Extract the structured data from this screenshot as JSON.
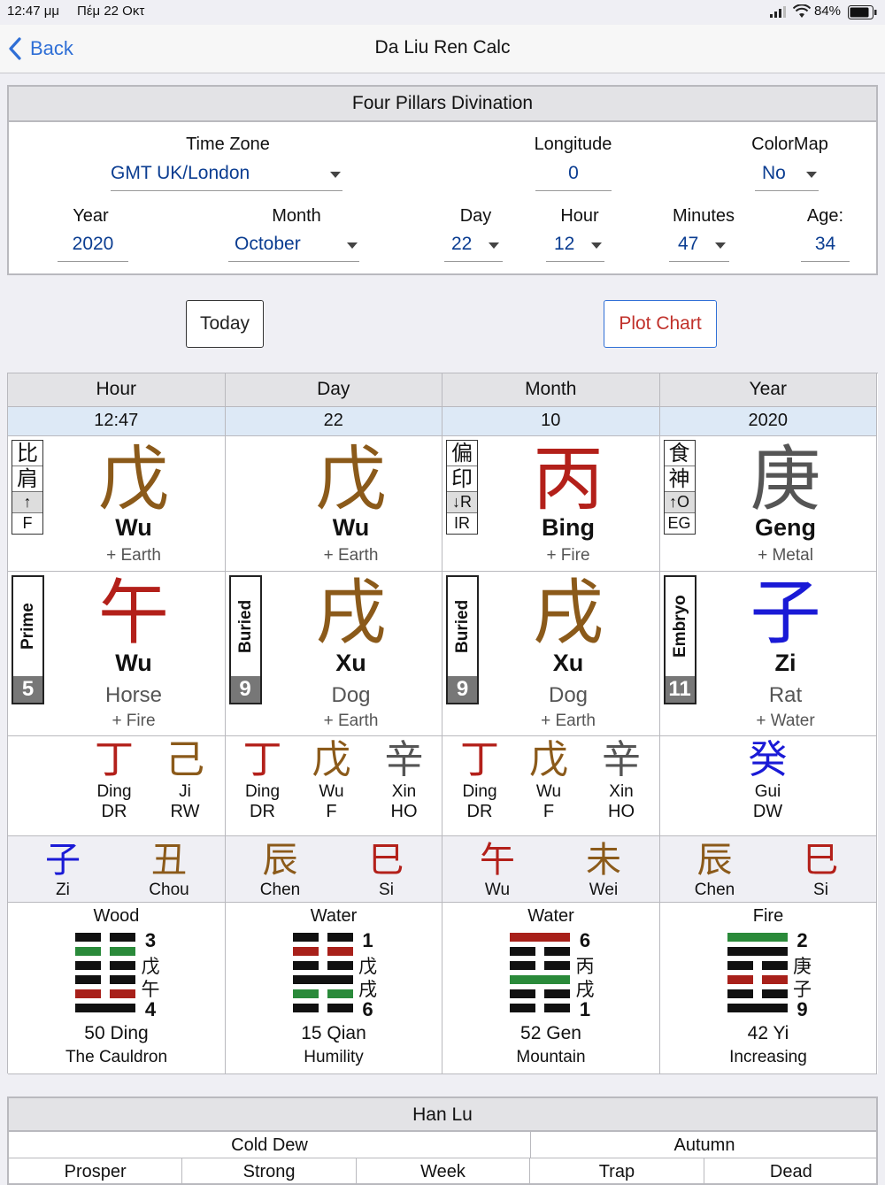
{
  "status": {
    "time": "12:47 μμ",
    "date": "Πέμ 22 Οκτ",
    "battery": "84%"
  },
  "nav": {
    "back": "Back",
    "title": "Da Liu Ren Calc"
  },
  "form": {
    "title": "Four Pillars Divination",
    "timezone_label": "Time Zone",
    "timezone_value": "GMT UK/London",
    "longitude_label": "Longitude",
    "longitude_value": "0",
    "colormap_label": "ColorMap",
    "colormap_value": "No",
    "year_label": "Year",
    "year_value": "2020",
    "month_label": "Month",
    "month_value": "October",
    "day_label": "Day",
    "day_value": "22",
    "hour_label": "Hour",
    "hour_value": "12",
    "minutes_label": "Minutes",
    "minutes_value": "47",
    "age_label": "Age:",
    "age_value": "34"
  },
  "buttons": {
    "today": "Today",
    "plot": "Plot Chart"
  },
  "colors": {
    "earth": "#8b5a1a",
    "fire": "#b3201a",
    "metal": "#555555",
    "water": "#1a1ad6",
    "accent": "#2f6fd6",
    "plot": "#c0302a"
  },
  "pillars": [
    {
      "header": "Hour",
      "value": "12:47",
      "stem": {
        "glyph": "戊",
        "pinyin": "Wu",
        "element": "+ Earth",
        "color": "#8b5a1a",
        "badge": [
          "比",
          "肩",
          "↑",
          "F"
        ]
      },
      "branch": {
        "glyph": "午",
        "pinyin": "Wu",
        "animal": "Horse",
        "element": "+ Fire",
        "color": "#b3201a",
        "tag": "Prime",
        "num": "5"
      },
      "hidden": [
        {
          "glyph": "丁",
          "name": "Ding",
          "code": "DR",
          "color": "#b3201a"
        },
        {
          "glyph": "己",
          "name": "Ji",
          "code": "RW",
          "color": "#8b5a1a"
        }
      ],
      "extra": [
        {
          "glyph": "子",
          "name": "Zi",
          "color": "#1a1ad6"
        },
        {
          "glyph": "丑",
          "name": "Chou",
          "color": "#8b5a1a"
        }
      ],
      "hex": {
        "element": "Wood",
        "nums": [
          "3",
          "戊",
          "午",
          "4"
        ],
        "name": "50 Ding",
        "meaning": "The Cauldron",
        "lines": [
          "y",
          "g",
          "y",
          "y",
          "r",
          "s"
        ]
      }
    },
    {
      "header": "Day",
      "value": "22",
      "stem": {
        "glyph": "戊",
        "pinyin": "Wu",
        "element": "+ Earth",
        "color": "#8b5a1a",
        "badge": []
      },
      "branch": {
        "glyph": "戌",
        "pinyin": "Xu",
        "animal": "Dog",
        "element": "+ Earth",
        "color": "#8b5a1a",
        "tag": "Buried",
        "num": "9"
      },
      "hidden": [
        {
          "glyph": "丁",
          "name": "Ding",
          "code": "DR",
          "color": "#b3201a"
        },
        {
          "glyph": "戊",
          "name": "Wu",
          "code": "F",
          "color": "#8b5a1a"
        },
        {
          "glyph": "辛",
          "name": "Xin",
          "code": "HO",
          "color": "#555555"
        }
      ],
      "extra": [
        {
          "glyph": "辰",
          "name": "Chen",
          "color": "#8b5a1a"
        },
        {
          "glyph": "巳",
          "name": "Si",
          "color": "#b3201a"
        }
      ],
      "hex": {
        "element": "Water",
        "nums": [
          "1",
          "戊",
          "戌",
          "6"
        ],
        "name": "15 Qian",
        "meaning": "Humility",
        "lines": [
          "b",
          "r",
          "b",
          "s",
          "g",
          "b"
        ]
      }
    },
    {
      "header": "Month",
      "value": "10",
      "stem": {
        "glyph": "丙",
        "pinyin": "Bing",
        "element": "+ Fire",
        "color": "#b3201a",
        "badge": [
          "偏",
          "印",
          "↓R",
          "IR"
        ]
      },
      "branch": {
        "glyph": "戌",
        "pinyin": "Xu",
        "animal": "Dog",
        "element": "+ Earth",
        "color": "#8b5a1a",
        "tag": "Buried",
        "num": "9"
      },
      "hidden": [
        {
          "glyph": "丁",
          "name": "Ding",
          "code": "DR",
          "color": "#b3201a"
        },
        {
          "glyph": "戊",
          "name": "Wu",
          "code": "F",
          "color": "#8b5a1a"
        },
        {
          "glyph": "辛",
          "name": "Xin",
          "code": "HO",
          "color": "#555555"
        }
      ],
      "extra": [
        {
          "glyph": "午",
          "name": "Wu",
          "color": "#b3201a"
        },
        {
          "glyph": "未",
          "name": "Wei",
          "color": "#8b5a1a"
        }
      ],
      "hex": {
        "element": "Water",
        "nums": [
          "6",
          "丙",
          "戌",
          "1"
        ],
        "name": "52 Gen",
        "meaning": "Mountain",
        "lines": [
          "R",
          "b",
          "b",
          "G",
          "b",
          "b"
        ]
      }
    },
    {
      "header": "Year",
      "value": "2020",
      "stem": {
        "glyph": "庚",
        "pinyin": "Geng",
        "element": "+ Metal",
        "color": "#555555",
        "badge": [
          "食",
          "神",
          "↑O",
          "EG"
        ]
      },
      "branch": {
        "glyph": "子",
        "pinyin": "Zi",
        "animal": "Rat",
        "element": "+ Water",
        "color": "#1a1ad6",
        "tag": "Embryo",
        "num": "11"
      },
      "hidden": [
        {
          "glyph": "癸",
          "name": "Gui",
          "code": "DW",
          "color": "#1a1ad6"
        }
      ],
      "extra": [
        {
          "glyph": "辰",
          "name": "Chen",
          "color": "#8b5a1a"
        },
        {
          "glyph": "巳",
          "name": "Si",
          "color": "#b3201a"
        }
      ],
      "hex": {
        "element": "Fire",
        "nums": [
          "2",
          "庚",
          "子",
          "9"
        ],
        "name": "42 Yi",
        "meaning": "Increasing",
        "lines": [
          "G",
          "s",
          "b",
          "r",
          "b",
          "s"
        ]
      }
    }
  ],
  "hanlu": {
    "title": "Han Lu",
    "season1": "Cold Dew",
    "season2": "Autumn",
    "cols": [
      "Prosper",
      "Strong",
      "Week",
      "Trap",
      "Dead"
    ]
  }
}
